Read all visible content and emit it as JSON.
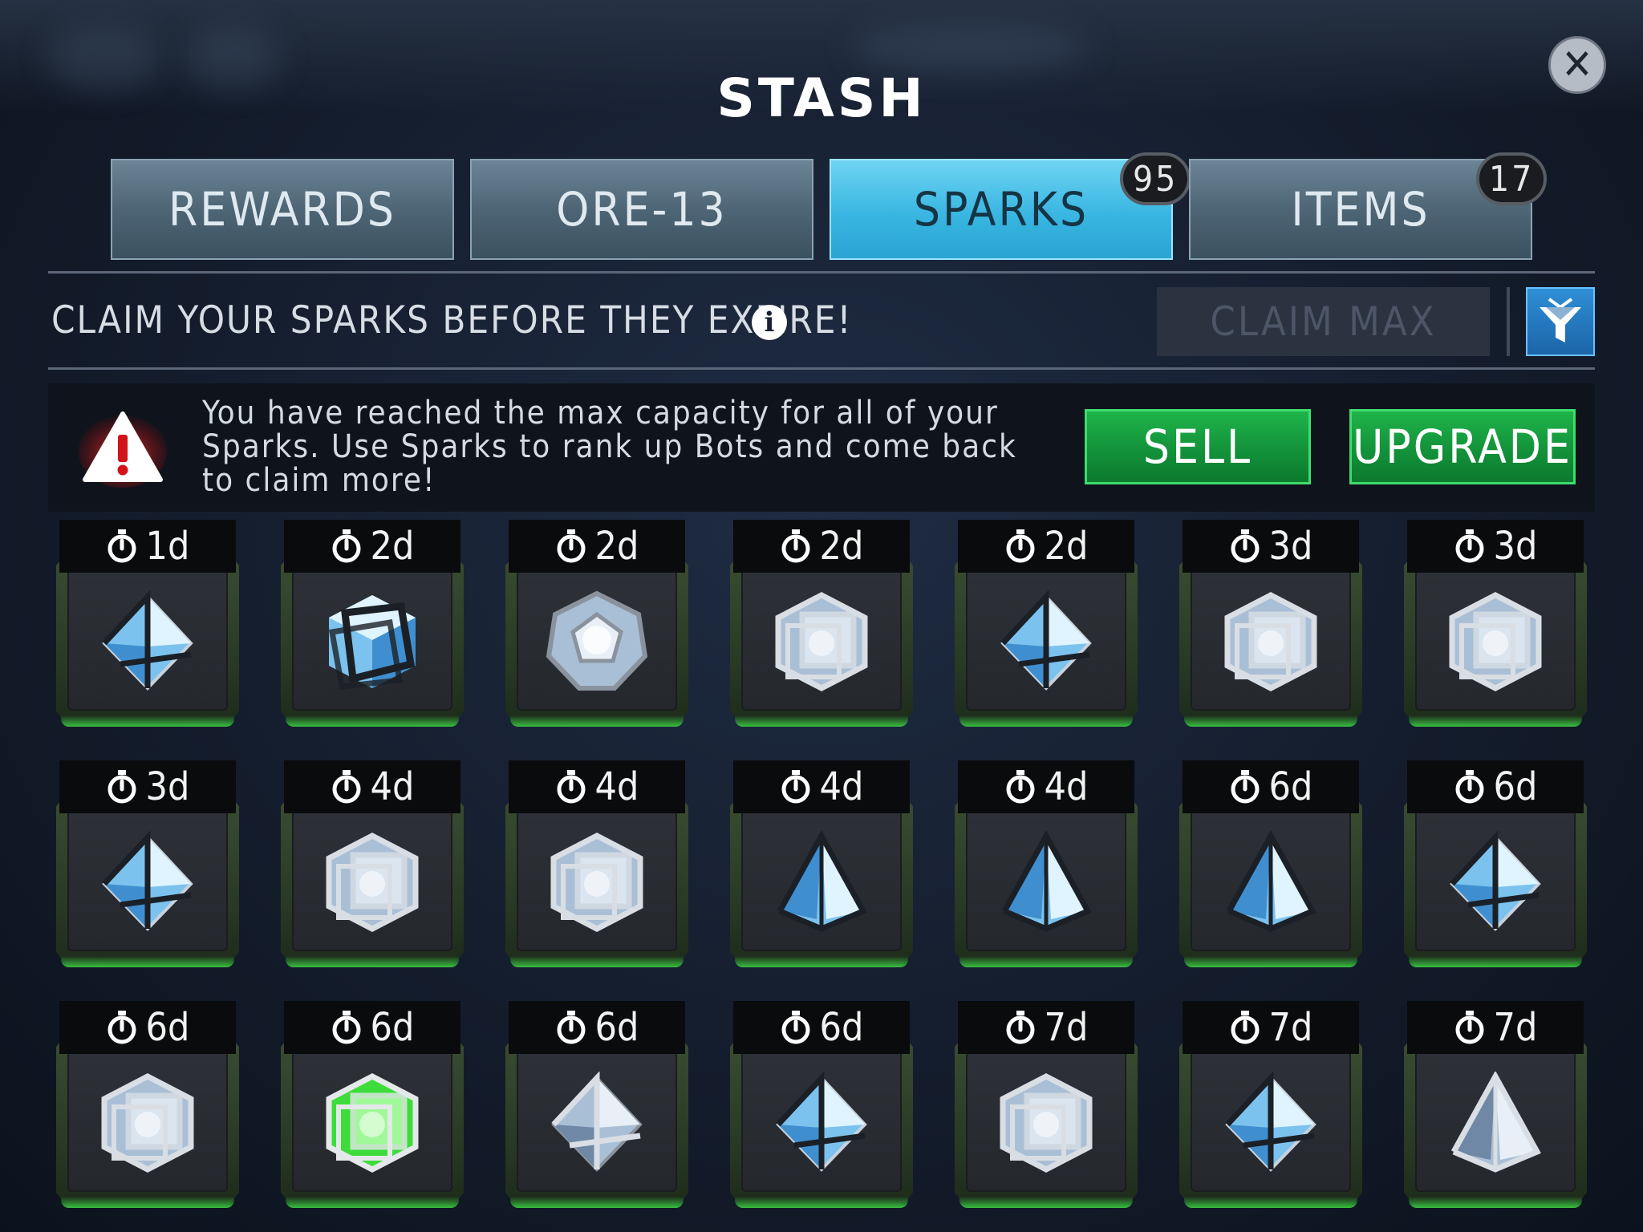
{
  "header": {
    "title": "STASH",
    "close_label": "✕"
  },
  "tabs": [
    {
      "label": "REWARDS",
      "badge": null,
      "active": false
    },
    {
      "label": "ORE-13",
      "badge": null,
      "active": false
    },
    {
      "label": "SPARKS",
      "badge": "95",
      "active": true
    },
    {
      "label": "ITEMS",
      "badge": "17",
      "active": false
    }
  ],
  "toolbar": {
    "message": "CLAIM YOUR SPARKS BEFORE THEY EXPIRE!",
    "info_label": "i",
    "claim_max_label": "CLAIM MAX",
    "filter_icon": "filter-funnel-icon"
  },
  "warning": {
    "text": "You have reached the max capacity for all of your Sparks. Use Sparks to rank up Bots and come back to claim more!",
    "sell_label": "SELL",
    "upgrade_label": "UPGRADE"
  },
  "colors": {
    "active_tab": "#39b6e2",
    "green_button": "#13923a",
    "warning_red": "#e01f26"
  },
  "sparks": [
    {
      "time": "1d",
      "shape": "octahedron",
      "tint": "blue"
    },
    {
      "time": "2d",
      "shape": "cube-dark",
      "tint": "blue"
    },
    {
      "time": "2d",
      "shape": "dodecahedron",
      "tint": "silver"
    },
    {
      "time": "2d",
      "shape": "cube",
      "tint": "silver"
    },
    {
      "time": "2d",
      "shape": "octahedron",
      "tint": "blue"
    },
    {
      "time": "3d",
      "shape": "cube",
      "tint": "silver"
    },
    {
      "time": "3d",
      "shape": "cube",
      "tint": "silver"
    },
    {
      "time": "3d",
      "shape": "octahedron",
      "tint": "blue"
    },
    {
      "time": "4d",
      "shape": "cube",
      "tint": "silver"
    },
    {
      "time": "4d",
      "shape": "cube",
      "tint": "silver"
    },
    {
      "time": "4d",
      "shape": "tetrahedron",
      "tint": "blue"
    },
    {
      "time": "4d",
      "shape": "tetrahedron",
      "tint": "blue"
    },
    {
      "time": "6d",
      "shape": "tetrahedron",
      "tint": "blue"
    },
    {
      "time": "6d",
      "shape": "octahedron",
      "tint": "blue"
    },
    {
      "time": "6d",
      "shape": "cube",
      "tint": "silver"
    },
    {
      "time": "6d",
      "shape": "cube",
      "tint": "green"
    },
    {
      "time": "6d",
      "shape": "octahedron",
      "tint": "silver"
    },
    {
      "time": "6d",
      "shape": "octahedron",
      "tint": "blue"
    },
    {
      "time": "7d",
      "shape": "cube",
      "tint": "silver"
    },
    {
      "time": "7d",
      "shape": "octahedron",
      "tint": "blue"
    },
    {
      "time": "7d",
      "shape": "tetrahedron",
      "tint": "silver"
    }
  ]
}
